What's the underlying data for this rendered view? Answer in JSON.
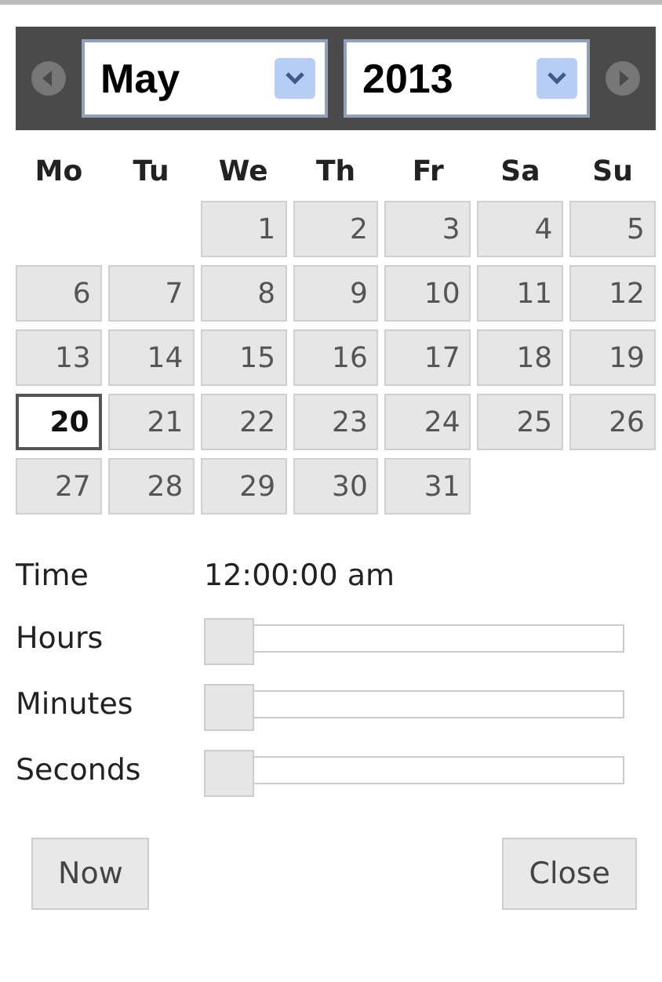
{
  "header": {
    "month": "May",
    "year": "2013"
  },
  "weekdays": [
    "Mo",
    "Tu",
    "We",
    "Th",
    "Fr",
    "Sa",
    "Su"
  ],
  "weeks": [
    [
      {
        "kind": "blank"
      },
      {
        "kind": "blank"
      },
      {
        "label": "1",
        "selected": false
      },
      {
        "label": "2",
        "selected": false
      },
      {
        "label": "3",
        "selected": false
      },
      {
        "label": "4",
        "selected": false
      },
      {
        "label": "5",
        "selected": false
      }
    ],
    [
      {
        "label": "6",
        "selected": false
      },
      {
        "label": "7",
        "selected": false
      },
      {
        "label": "8",
        "selected": false
      },
      {
        "label": "9",
        "selected": false
      },
      {
        "label": "10",
        "selected": false
      },
      {
        "label": "11",
        "selected": false
      },
      {
        "label": "12",
        "selected": false
      }
    ],
    [
      {
        "label": "13",
        "selected": false
      },
      {
        "label": "14",
        "selected": false
      },
      {
        "label": "15",
        "selected": false
      },
      {
        "label": "16",
        "selected": false
      },
      {
        "label": "17",
        "selected": false
      },
      {
        "label": "18",
        "selected": false
      },
      {
        "label": "19",
        "selected": false
      }
    ],
    [
      {
        "label": "20",
        "selected": true
      },
      {
        "label": "21",
        "selected": false
      },
      {
        "label": "22",
        "selected": false
      },
      {
        "label": "23",
        "selected": false
      },
      {
        "label": "24",
        "selected": false
      },
      {
        "label": "25",
        "selected": false
      },
      {
        "label": "26",
        "selected": false
      }
    ],
    [
      {
        "label": "27",
        "selected": false
      },
      {
        "label": "28",
        "selected": false
      },
      {
        "label": "29",
        "selected": false
      },
      {
        "label": "30",
        "selected": false
      },
      {
        "label": "31",
        "selected": false
      },
      {
        "kind": "blank"
      },
      {
        "kind": "blank"
      }
    ]
  ],
  "time": {
    "label": "Time",
    "value": "12:00:00 am"
  },
  "sliders": [
    {
      "label": "Hours",
      "level": 0
    },
    {
      "label": "Minutes",
      "level": 0
    },
    {
      "label": "Seconds",
      "level": 0
    }
  ],
  "buttons": {
    "now": "Now",
    "close": "Close"
  }
}
